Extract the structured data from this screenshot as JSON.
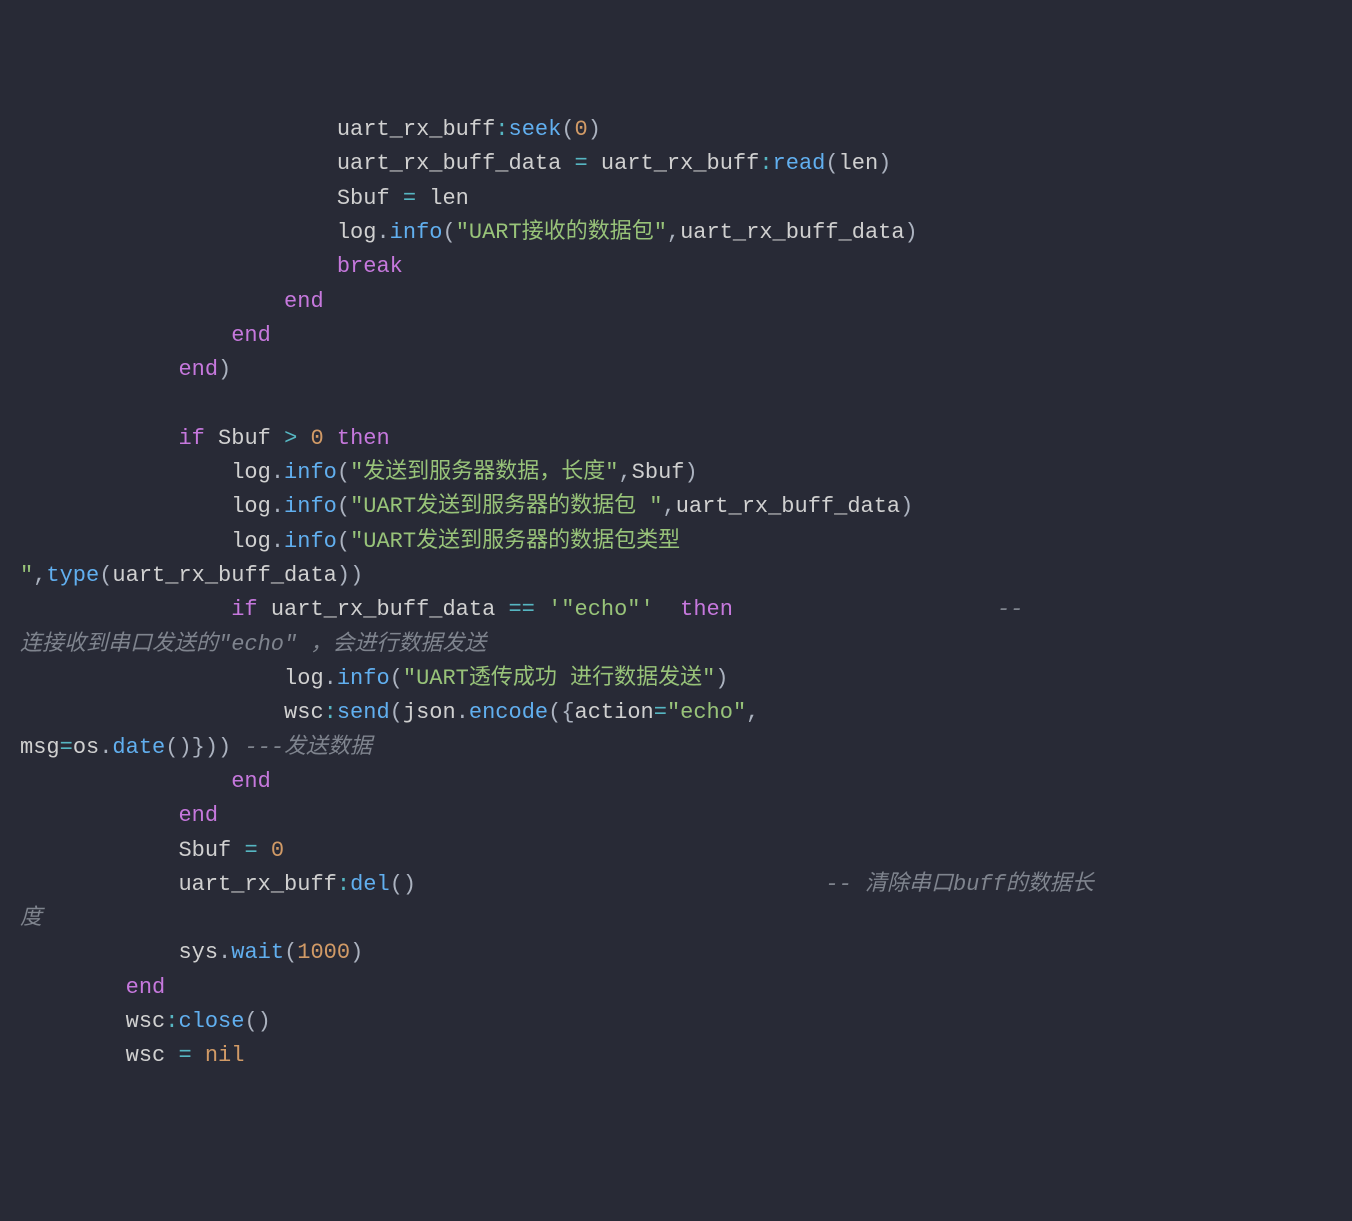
{
  "code": {
    "l1": {
      "ind": "                        ",
      "a": "uart_rx_buff",
      "b": ":",
      "c": "seek",
      "d": "(",
      "e": "0",
      "f": ")"
    },
    "l2": {
      "ind": "                        ",
      "a": "uart_rx_buff_data ",
      "b": "=",
      "c": " uart_rx_buff",
      "d": ":",
      "e": "read",
      "f": "(",
      "g": "len",
      "h": ")"
    },
    "l3": {
      "ind": "                        ",
      "a": "Sbuf ",
      "b": "=",
      "c": " len"
    },
    "l4": {
      "ind": "                        ",
      "a": "log",
      "b": ".",
      "c": "info",
      "d": "(",
      "e": "\"UART接收的数据包\"",
      "f": ",",
      "g": "uart_rx_buff_data",
      "h": ")"
    },
    "l5": {
      "ind": "                        ",
      "a": "break"
    },
    "l6": {
      "ind": "                    ",
      "a": "end"
    },
    "l7": {
      "ind": "                ",
      "a": "end"
    },
    "l8": {
      "ind": "            ",
      "a": "end",
      "b": ")"
    },
    "l9": {
      "ind": ""
    },
    "l10": {
      "ind": "            ",
      "a": "if",
      "b": " Sbuf ",
      "c": ">",
      "d": " ",
      "e": "0",
      "f": " ",
      "g": "then"
    },
    "l11": {
      "ind": "                ",
      "a": "log",
      "b": ".",
      "c": "info",
      "d": "(",
      "e": "\"发送到服务器数据，长度\"",
      "f": ",",
      "g": "Sbuf",
      "h": ")"
    },
    "l12": {
      "ind": "                ",
      "a": "log",
      "b": ".",
      "c": "info",
      "d": "(",
      "e": "\"UART发送到服务器的数据包 \"",
      "f": ",",
      "g": "uart_rx_buff_data",
      "h": ")"
    },
    "l13": {
      "ind": "                ",
      "a": "log",
      "b": ".",
      "c": "info",
      "d": "(",
      "e": "\"UART发送到服务器的数据包类型 "
    },
    "l14": {
      "ind": "",
      "a": "\"",
      "b": ",",
      "c": "type",
      "d": "(",
      "e": "uart_rx_buff_data",
      "f": ")",
      ")": ")"
    },
    "l15": {
      "ind": "                ",
      "a": "if",
      "b": " uart_rx_buff_data ",
      "c": "==",
      "d": " ",
      "e": "'\"echo\"'",
      "f": "  ",
      "g": "then",
      "sp": "                    ",
      "h": "--"
    },
    "l16": {
      "ind": "",
      "a": "连接收到串口发送的\"echo\" ，会进行数据发送"
    },
    "l17": {
      "ind": "                    ",
      "a": "log",
      "b": ".",
      "c": "info",
      "d": "(",
      "e": "\"UART透传成功 进行数据发送\"",
      "f": ")"
    },
    "l18": {
      "ind": "                    ",
      "a": "wsc",
      "b": ":",
      "c": "send",
      "d": "(",
      "e": "json",
      "f": ".",
      "g": "encode",
      "h": "(",
      "i": "{",
      "j": "action",
      "k": "=",
      "l": "\"echo\"",
      "m": ","
    },
    "l19": {
      "ind": "",
      "a": "msg",
      "b": "=",
      "c": "os",
      "d": ".",
      "e": "date",
      "f": "(",
      ")": ")",
      "g": "}",
      "h": ")",
      ")2": ")",
      "sp": " ",
      "i": "---发送数据"
    },
    "l20": {
      "ind": "                ",
      "a": "end"
    },
    "l21": {
      "ind": "            ",
      "a": "end"
    },
    "l22": {
      "ind": "            ",
      "a": "Sbuf ",
      "b": "=",
      "c": " ",
      "d": "0"
    },
    "l23": {
      "ind": "            ",
      "a": "uart_rx_buff",
      "b": ":",
      "c": "del",
      "d": "(",
      ")": ")",
      "sp": "                               ",
      "e": "-- 清除串口buff的数据长"
    },
    "l24": {
      "ind": "",
      "a": "度"
    },
    "l25": {
      "ind": "            ",
      "a": "sys",
      "b": ".",
      "c": "wait",
      "d": "(",
      "e": "1000",
      "f": ")"
    },
    "l26": {
      "ind": "        ",
      "a": "end"
    },
    "l27": {
      "ind": "        ",
      "a": "wsc",
      "b": ":",
      "c": "close",
      "d": "(",
      ")": ")"
    },
    "l28": {
      "ind": "        ",
      "a": "wsc ",
      "b": "=",
      "c": " ",
      "d": "nil"
    }
  }
}
